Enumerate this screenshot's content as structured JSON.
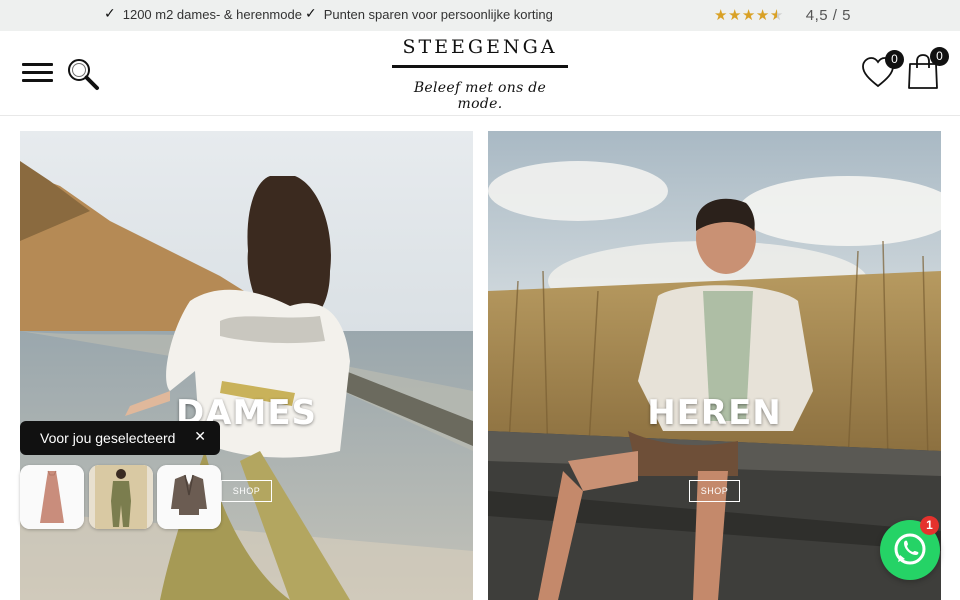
{
  "topbar": {
    "usp_1": "1200 m2 dames- & herenmode",
    "usp_2": "Punten sparen voor persoonlijke korting",
    "rating_text": "4,5 / 5",
    "rating_value": 4.5,
    "rating_max": 5,
    "check_icon": "check-icon",
    "star_color": "#d9a126"
  },
  "header": {
    "logo_name": "STEEGENGA",
    "logo_tagline": "Beleef met ons de mode.",
    "wishlist_count": "0",
    "cart_count": "0"
  },
  "tiles": [
    {
      "title": "DAMES",
      "button": "SHOP"
    },
    {
      "title": "HEREN",
      "button": "SHOP"
    }
  ],
  "selected": {
    "label": "Voor jou geselecteerd",
    "close": "✕"
  },
  "whatsapp": {
    "badge": "1",
    "color": "#25d366"
  }
}
